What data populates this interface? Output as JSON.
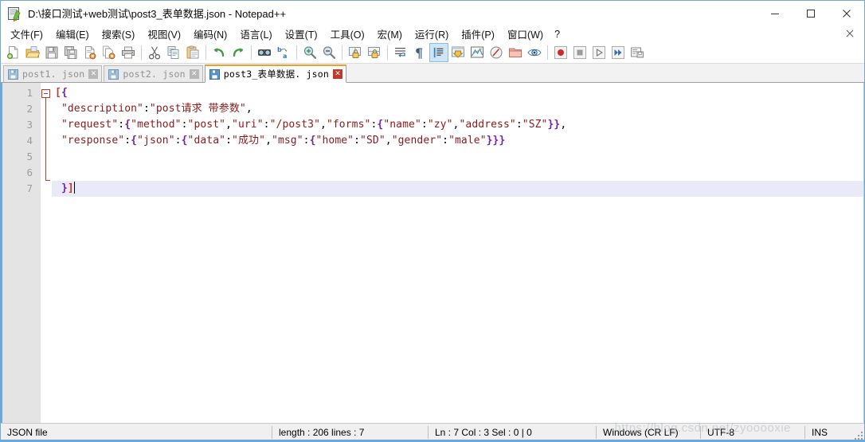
{
  "window": {
    "title": "D:\\接口测试+web测试\\post3_表单数据.json - Notepad++",
    "icon_name": "notepad-plus-plus-icon",
    "minimize_label": "—",
    "maximize_label": "□",
    "close_label": "✕",
    "doc_close_label": "✕"
  },
  "menu": {
    "items": [
      {
        "label": "文件(F)"
      },
      {
        "label": "编辑(E)"
      },
      {
        "label": "搜索(S)"
      },
      {
        "label": "视图(V)"
      },
      {
        "label": "编码(N)"
      },
      {
        "label": "语言(L)"
      },
      {
        "label": "设置(T)"
      },
      {
        "label": "工具(O)"
      },
      {
        "label": "宏(M)"
      },
      {
        "label": "运行(R)"
      },
      {
        "label": "插件(P)"
      },
      {
        "label": "窗口(W)"
      },
      {
        "label": "?"
      }
    ]
  },
  "toolbar": {
    "buttons": [
      {
        "icon": "new-file-icon"
      },
      {
        "icon": "open-folder-icon"
      },
      {
        "icon": "save-icon"
      },
      {
        "icon": "save-all-icon"
      },
      {
        "icon": "close-file-icon"
      },
      {
        "icon": "close-all-files-icon"
      },
      {
        "icon": "print-icon"
      },
      {
        "icon": "separator"
      },
      {
        "icon": "cut-icon"
      },
      {
        "icon": "copy-icon"
      },
      {
        "icon": "paste-icon"
      },
      {
        "icon": "separator"
      },
      {
        "icon": "undo-icon"
      },
      {
        "icon": "redo-icon"
      },
      {
        "icon": "separator"
      },
      {
        "icon": "find-icon"
      },
      {
        "icon": "replace-icon"
      },
      {
        "icon": "separator"
      },
      {
        "icon": "zoom-in-icon"
      },
      {
        "icon": "zoom-out-icon"
      },
      {
        "icon": "separator"
      },
      {
        "icon": "sync-vertical-scroll-icon"
      },
      {
        "icon": "sync-horizontal-scroll-icon"
      },
      {
        "icon": "word-wrap-icon"
      },
      {
        "icon": "show-all-characters-icon"
      },
      {
        "icon": "indent-guide-icon"
      },
      {
        "icon": "user-defined-dialog-icon"
      },
      {
        "icon": "document-map-icon"
      },
      {
        "icon": "function-list-icon"
      },
      {
        "icon": "folder-as-workspace-icon"
      },
      {
        "icon": "monitoring-icon"
      },
      {
        "icon": "separator"
      },
      {
        "icon": "record-macro-icon"
      },
      {
        "icon": "stop-macro-icon"
      },
      {
        "icon": "play-macro-icon"
      },
      {
        "icon": "play-macro-multiple-icon"
      },
      {
        "icon": "save-macro-icon"
      }
    ]
  },
  "tabs": [
    {
      "label": "post1. json",
      "active": false,
      "icon": "saved-file-icon",
      "close_label": "✕"
    },
    {
      "label": "post2. json",
      "active": false,
      "icon": "saved-file-icon",
      "close_label": "✕"
    },
    {
      "label": "post3_表单数据. json",
      "active": true,
      "icon": "saved-file-icon",
      "close_label": "✕"
    }
  ],
  "editor": {
    "line_numbers": [
      "1",
      "2",
      "3",
      "4",
      "5",
      "6",
      "7"
    ],
    "lines": [
      {
        "number": "1",
        "current": false,
        "tokens": [
          {
            "t": "[",
            "k": "bracket"
          },
          {
            "t": "{",
            "k": "brace"
          }
        ]
      },
      {
        "number": "2",
        "current": false,
        "tokens": [
          {
            "t": " ",
            "k": "punct"
          },
          {
            "t": "\"description\"",
            "k": "str"
          },
          {
            "t": ":",
            "k": "punct"
          },
          {
            "t": "\"post请求 带参数\"",
            "k": "str"
          },
          {
            "t": ",",
            "k": "punct"
          }
        ]
      },
      {
        "number": "3",
        "current": false,
        "tokens": [
          {
            "t": " ",
            "k": "punct"
          },
          {
            "t": "\"request\"",
            "k": "str"
          },
          {
            "t": ":",
            "k": "punct"
          },
          {
            "t": "{",
            "k": "brace"
          },
          {
            "t": "\"method\"",
            "k": "str"
          },
          {
            "t": ":",
            "k": "punct"
          },
          {
            "t": "\"post\"",
            "k": "str"
          },
          {
            "t": ",",
            "k": "punct"
          },
          {
            "t": "\"uri\"",
            "k": "str"
          },
          {
            "t": ":",
            "k": "punct"
          },
          {
            "t": "\"/post3\"",
            "k": "str"
          },
          {
            "t": ",",
            "k": "punct"
          },
          {
            "t": "\"forms\"",
            "k": "str"
          },
          {
            "t": ":",
            "k": "punct"
          },
          {
            "t": "{",
            "k": "brace"
          },
          {
            "t": "\"name\"",
            "k": "str"
          },
          {
            "t": ":",
            "k": "punct"
          },
          {
            "t": "\"zy\"",
            "k": "str"
          },
          {
            "t": ",",
            "k": "punct"
          },
          {
            "t": "\"address\"",
            "k": "str"
          },
          {
            "t": ":",
            "k": "punct"
          },
          {
            "t": "\"SZ\"",
            "k": "str"
          },
          {
            "t": "}}",
            "k": "brace"
          },
          {
            "t": ",",
            "k": "punct"
          }
        ]
      },
      {
        "number": "4",
        "current": false,
        "tokens": [
          {
            "t": " ",
            "k": "punct"
          },
          {
            "t": "\"response\"",
            "k": "str"
          },
          {
            "t": ":",
            "k": "punct"
          },
          {
            "t": "{",
            "k": "brace"
          },
          {
            "t": "\"json\"",
            "k": "str"
          },
          {
            "t": ":",
            "k": "punct"
          },
          {
            "t": "{",
            "k": "brace"
          },
          {
            "t": "\"data\"",
            "k": "str"
          },
          {
            "t": ":",
            "k": "punct"
          },
          {
            "t": "\"成功\"",
            "k": "str"
          },
          {
            "t": ",",
            "k": "punct"
          },
          {
            "t": "\"msg\"",
            "k": "str"
          },
          {
            "t": ":",
            "k": "punct"
          },
          {
            "t": "{",
            "k": "brace"
          },
          {
            "t": "\"home\"",
            "k": "str"
          },
          {
            "t": ":",
            "k": "punct"
          },
          {
            "t": "\"SD\"",
            "k": "str"
          },
          {
            "t": ",",
            "k": "punct"
          },
          {
            "t": "\"gender\"",
            "k": "str"
          },
          {
            "t": ":",
            "k": "punct"
          },
          {
            "t": "\"male\"",
            "k": "str"
          },
          {
            "t": "}}}",
            "k": "brace"
          }
        ]
      },
      {
        "number": "5",
        "current": false,
        "tokens": []
      },
      {
        "number": "6",
        "current": false,
        "tokens": []
      },
      {
        "number": "7",
        "current": true,
        "tokens": [
          {
            "t": " ",
            "k": "punct"
          },
          {
            "t": "}",
            "k": "brace"
          },
          {
            "t": "]",
            "k": "bracket"
          }
        ]
      }
    ],
    "full_text": "[{\n \"description\":\"post请求 带参数\",\n \"request\":{\"method\":\"post\",\"uri\":\"/post3\",\"forms\":{\"name\":\"zy\",\"address\":\"SZ\"}},\n \"response\":{\"json\":{\"data\":\"成功\",\"msg\":{\"home\":\"SD\",\"gender\":\"male\"}}}\n\n\n }]",
    "colors": {
      "string": "#8b1a1a",
      "brace": "#7a1fa2",
      "bracket": "#c0392b",
      "punct": "#000000",
      "current_line_bg": "#e9e9f8",
      "gutter_bg": "#e4e4e4",
      "line_number": "#9c9c9c"
    }
  },
  "statusbar": {
    "file_type": "JSON file",
    "length_lines": "length : 206    lines : 7",
    "position": "Ln : 7    Col : 3    Sel : 0 | 0",
    "eol": "Windows (CR LF)",
    "encoding": "UTF-8",
    "insert_mode": "INS",
    "watermark": "https://blog.csdn.net/zyooooxie"
  }
}
